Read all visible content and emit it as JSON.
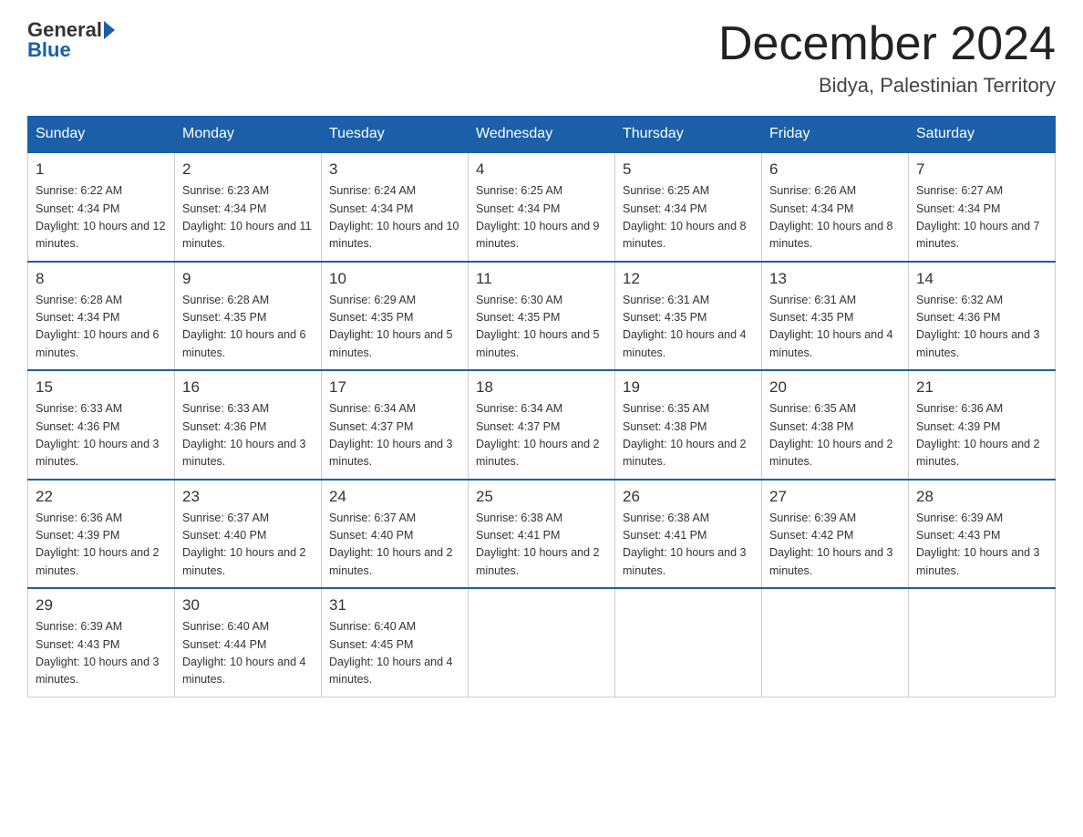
{
  "header": {
    "logo_general": "General",
    "logo_blue": "Blue",
    "month": "December 2024",
    "location": "Bidya, Palestinian Territory"
  },
  "days_of_week": [
    "Sunday",
    "Monday",
    "Tuesday",
    "Wednesday",
    "Thursday",
    "Friday",
    "Saturday"
  ],
  "weeks": [
    [
      {
        "day": "1",
        "sunrise": "6:22 AM",
        "sunset": "4:34 PM",
        "daylight": "10 hours and 12 minutes."
      },
      {
        "day": "2",
        "sunrise": "6:23 AM",
        "sunset": "4:34 PM",
        "daylight": "10 hours and 11 minutes."
      },
      {
        "day": "3",
        "sunrise": "6:24 AM",
        "sunset": "4:34 PM",
        "daylight": "10 hours and 10 minutes."
      },
      {
        "day": "4",
        "sunrise": "6:25 AM",
        "sunset": "4:34 PM",
        "daylight": "10 hours and 9 minutes."
      },
      {
        "day": "5",
        "sunrise": "6:25 AM",
        "sunset": "4:34 PM",
        "daylight": "10 hours and 8 minutes."
      },
      {
        "day": "6",
        "sunrise": "6:26 AM",
        "sunset": "4:34 PM",
        "daylight": "10 hours and 8 minutes."
      },
      {
        "day": "7",
        "sunrise": "6:27 AM",
        "sunset": "4:34 PM",
        "daylight": "10 hours and 7 minutes."
      }
    ],
    [
      {
        "day": "8",
        "sunrise": "6:28 AM",
        "sunset": "4:34 PM",
        "daylight": "10 hours and 6 minutes."
      },
      {
        "day": "9",
        "sunrise": "6:28 AM",
        "sunset": "4:35 PM",
        "daylight": "10 hours and 6 minutes."
      },
      {
        "day": "10",
        "sunrise": "6:29 AM",
        "sunset": "4:35 PM",
        "daylight": "10 hours and 5 minutes."
      },
      {
        "day": "11",
        "sunrise": "6:30 AM",
        "sunset": "4:35 PM",
        "daylight": "10 hours and 5 minutes."
      },
      {
        "day": "12",
        "sunrise": "6:31 AM",
        "sunset": "4:35 PM",
        "daylight": "10 hours and 4 minutes."
      },
      {
        "day": "13",
        "sunrise": "6:31 AM",
        "sunset": "4:35 PM",
        "daylight": "10 hours and 4 minutes."
      },
      {
        "day": "14",
        "sunrise": "6:32 AM",
        "sunset": "4:36 PM",
        "daylight": "10 hours and 3 minutes."
      }
    ],
    [
      {
        "day": "15",
        "sunrise": "6:33 AM",
        "sunset": "4:36 PM",
        "daylight": "10 hours and 3 minutes."
      },
      {
        "day": "16",
        "sunrise": "6:33 AM",
        "sunset": "4:36 PM",
        "daylight": "10 hours and 3 minutes."
      },
      {
        "day": "17",
        "sunrise": "6:34 AM",
        "sunset": "4:37 PM",
        "daylight": "10 hours and 3 minutes."
      },
      {
        "day": "18",
        "sunrise": "6:34 AM",
        "sunset": "4:37 PM",
        "daylight": "10 hours and 2 minutes."
      },
      {
        "day": "19",
        "sunrise": "6:35 AM",
        "sunset": "4:38 PM",
        "daylight": "10 hours and 2 minutes."
      },
      {
        "day": "20",
        "sunrise": "6:35 AM",
        "sunset": "4:38 PM",
        "daylight": "10 hours and 2 minutes."
      },
      {
        "day": "21",
        "sunrise": "6:36 AM",
        "sunset": "4:39 PM",
        "daylight": "10 hours and 2 minutes."
      }
    ],
    [
      {
        "day": "22",
        "sunrise": "6:36 AM",
        "sunset": "4:39 PM",
        "daylight": "10 hours and 2 minutes."
      },
      {
        "day": "23",
        "sunrise": "6:37 AM",
        "sunset": "4:40 PM",
        "daylight": "10 hours and 2 minutes."
      },
      {
        "day": "24",
        "sunrise": "6:37 AM",
        "sunset": "4:40 PM",
        "daylight": "10 hours and 2 minutes."
      },
      {
        "day": "25",
        "sunrise": "6:38 AM",
        "sunset": "4:41 PM",
        "daylight": "10 hours and 2 minutes."
      },
      {
        "day": "26",
        "sunrise": "6:38 AM",
        "sunset": "4:41 PM",
        "daylight": "10 hours and 3 minutes."
      },
      {
        "day": "27",
        "sunrise": "6:39 AM",
        "sunset": "4:42 PM",
        "daylight": "10 hours and 3 minutes."
      },
      {
        "day": "28",
        "sunrise": "6:39 AM",
        "sunset": "4:43 PM",
        "daylight": "10 hours and 3 minutes."
      }
    ],
    [
      {
        "day": "29",
        "sunrise": "6:39 AM",
        "sunset": "4:43 PM",
        "daylight": "10 hours and 3 minutes."
      },
      {
        "day": "30",
        "sunrise": "6:40 AM",
        "sunset": "4:44 PM",
        "daylight": "10 hours and 4 minutes."
      },
      {
        "day": "31",
        "sunrise": "6:40 AM",
        "sunset": "4:45 PM",
        "daylight": "10 hours and 4 minutes."
      },
      null,
      null,
      null,
      null
    ]
  ]
}
